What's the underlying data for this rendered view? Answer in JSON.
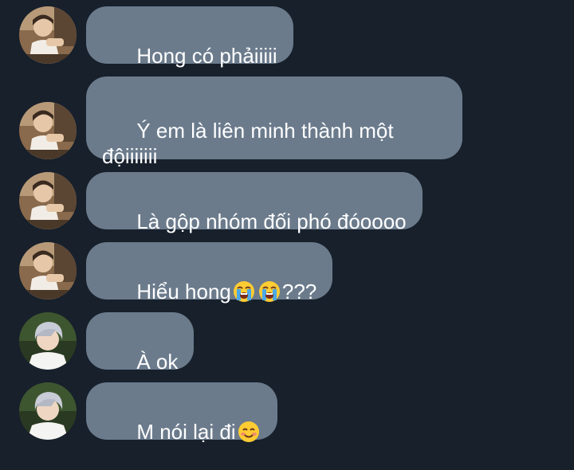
{
  "messages": [
    {
      "sender": "avatar-a",
      "text": "Hong có phảiiiii"
    },
    {
      "sender": "avatar-a",
      "text": "Ý em là liên minh thành một độiiiiiii"
    },
    {
      "sender": "avatar-a",
      "text": "Là gộp nhóm đối phó đóoooo"
    },
    {
      "sender": "avatar-a",
      "text_before": "Hiểu hong",
      "emoji": [
        "loudly-crying-face",
        "loudly-crying-face"
      ],
      "text_after": "???"
    },
    {
      "sender": "avatar-b",
      "text": "À ok"
    },
    {
      "sender": "avatar-b",
      "text_before": "M nói lại đi",
      "emoji": [
        "smiling-face"
      ]
    }
  ],
  "colors": {
    "background": "#17202b",
    "bubble": "#6b7b8c",
    "text": "#ffffff"
  }
}
